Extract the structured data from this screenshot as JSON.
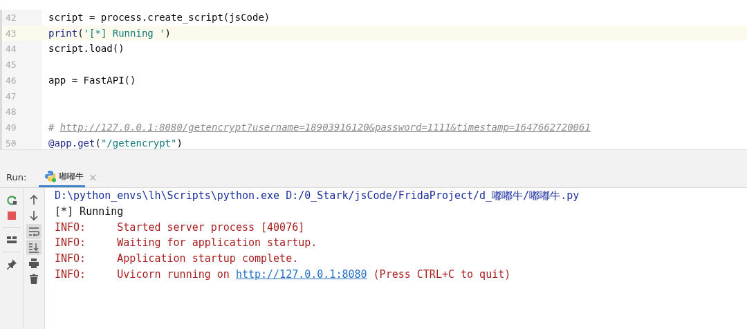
{
  "editor": {
    "lines": [
      {
        "number": "42",
        "current": false,
        "tokens": [
          {
            "kind": "plain",
            "text": "script = process.create_script(jsCode)"
          }
        ]
      },
      {
        "number": "43",
        "current": true,
        "tokens": [
          {
            "kind": "builtin",
            "text": "print"
          },
          {
            "kind": "plain",
            "text": "("
          },
          {
            "kind": "string",
            "text": "'[*] Running '"
          },
          {
            "kind": "plain",
            "text": ")"
          }
        ]
      },
      {
        "number": "44",
        "current": false,
        "tokens": [
          {
            "kind": "plain",
            "text": "script.load()"
          }
        ]
      },
      {
        "number": "45",
        "current": false
      },
      {
        "number": "46",
        "current": false,
        "tokens": [
          {
            "kind": "plain",
            "text": "app = FastAPI()"
          }
        ]
      },
      {
        "number": "47",
        "current": false
      },
      {
        "number": "48",
        "current": false
      },
      {
        "number": "49",
        "current": false,
        "tokens": [
          {
            "kind": "comment",
            "text": "# "
          },
          {
            "kind": "commentlink",
            "text": "http://127.0.0.1:8080/getencrypt?username=18903916120&password=1111&timestamp=1647662720061"
          }
        ]
      },
      {
        "number": "50",
        "current": false,
        "tokens": [
          {
            "kind": "builtin",
            "text": "@app.get"
          },
          {
            "kind": "plain",
            "text": "("
          },
          {
            "kind": "string",
            "text": "\"/getencrypt\""
          },
          {
            "kind": "plain",
            "text": ")"
          }
        ]
      }
    ]
  },
  "run_panel": {
    "label": "Run:",
    "tabs": [
      {
        "title": "嘟嘟牛",
        "selected": true,
        "close": "×"
      }
    ],
    "left_tools": [
      {
        "kind": "rerun",
        "on": false
      },
      {
        "kind": "stop",
        "on": false
      },
      {
        "kind": "layout",
        "on": false
      },
      {
        "kind": "pin",
        "on": false
      }
    ],
    "right_tools": [
      {
        "kind": "up",
        "on": false
      },
      {
        "kind": "down",
        "on": false
      },
      {
        "kind": "wrap",
        "on": true
      },
      {
        "kind": "scrollend",
        "on": true
      },
      {
        "kind": "print",
        "on": false
      },
      {
        "kind": "trash",
        "on": false
      }
    ],
    "console": [
      {
        "tokens": [
          {
            "kind": "path",
            "text": "D:\\python_envs\\lh\\Scripts\\python.exe D:/0_Stark/jsCode/FridaProject/d_嘟嘟牛/嘟嘟牛.py"
          }
        ]
      },
      {
        "tokens": [
          {
            "kind": "plain",
            "text": "[*] Running"
          }
        ]
      },
      {
        "tokens": [
          {
            "kind": "error",
            "text": "INFO:     Started server process [40076]"
          }
        ]
      },
      {
        "tokens": [
          {
            "kind": "error",
            "text": "INFO:     Waiting for application startup."
          }
        ]
      },
      {
        "tokens": [
          {
            "kind": "error",
            "text": "INFO:     Application startup complete."
          }
        ]
      },
      {
        "tokens": [
          {
            "kind": "error",
            "text": "INFO:     Uvicorn running on "
          },
          {
            "kind": "link",
            "text": "http://127.0.0.1:8080"
          },
          {
            "kind": "error",
            "text": " (Press CTRL+C to quit)"
          }
        ]
      }
    ]
  }
}
